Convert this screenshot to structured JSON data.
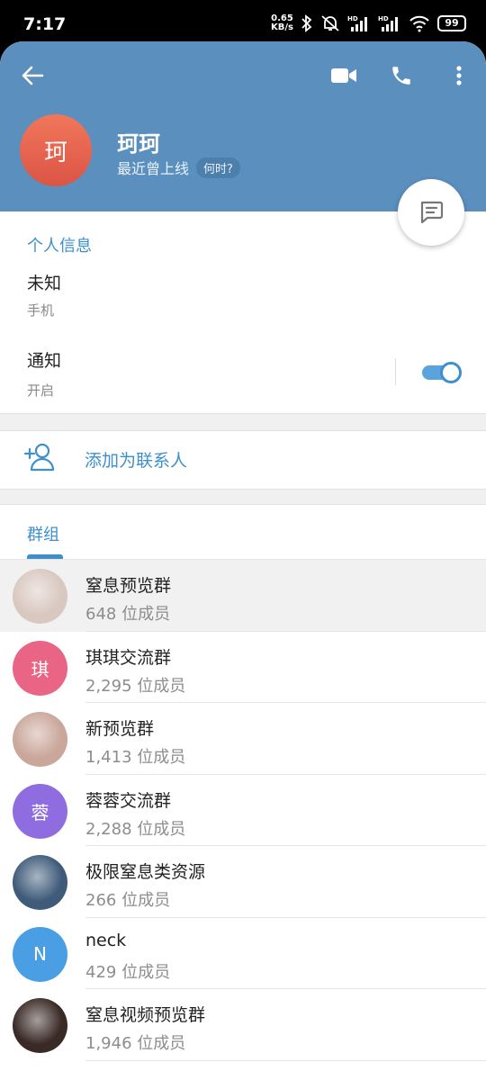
{
  "status": {
    "time": "7:17",
    "speed_value": "0.65",
    "speed_unit": "KB/s",
    "battery": "99"
  },
  "header": {
    "avatar_char": "珂",
    "avatar_color": "#e8624d",
    "name": "珂珂",
    "last_seen": "最近曾上线",
    "when_badge": "何时?"
  },
  "personal": {
    "title": "个人信息",
    "phone_value": "未知",
    "phone_label": "手机",
    "notif_value": "通知",
    "notif_label": "开启",
    "notif_enabled": true
  },
  "add_contact": {
    "label": "添加为联系人"
  },
  "groups": {
    "tab_label": "群组",
    "items": [
      {
        "name": "窒息预览群",
        "count": "648 位成员",
        "avatar_char": "",
        "avatar_color": "#d9c8c0",
        "selected": true
      },
      {
        "name": "琪琪交流群",
        "count": "2,295 位成员",
        "avatar_char": "琪",
        "avatar_color": "#e96485",
        "selected": false
      },
      {
        "name": "新预览群",
        "count": "1,413 位成员",
        "avatar_char": "",
        "avatar_color": "#caa79a",
        "selected": false
      },
      {
        "name": "蓉蓉交流群",
        "count": "2,288 位成员",
        "avatar_char": "蓉",
        "avatar_color": "#8f6de0",
        "selected": false
      },
      {
        "name": "极限窒息类资源",
        "count": "266 位成员",
        "avatar_char": "",
        "avatar_color": "#3f5b7a",
        "selected": false
      },
      {
        "name": "neck",
        "count": "429 位成员",
        "avatar_char": "N",
        "avatar_color": "#4a9ee3",
        "selected": false
      },
      {
        "name": "窒息视频预览群",
        "count": "1,946 位成员",
        "avatar_char": "",
        "avatar_color": "#3a2a26",
        "selected": false
      }
    ]
  }
}
